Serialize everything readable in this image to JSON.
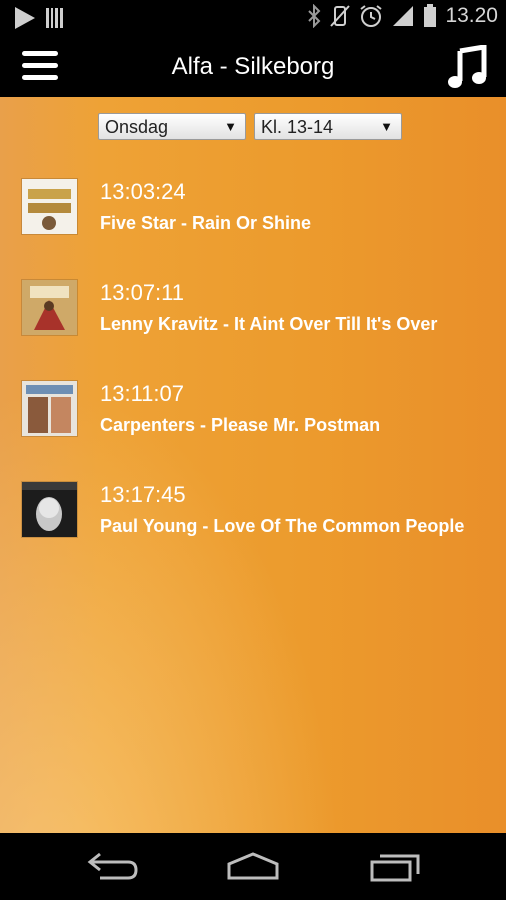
{
  "status_bar": {
    "time": "13.20",
    "icons": [
      "play-icon",
      "barcode-icon",
      "bluetooth-icon",
      "vibrate-off-icon",
      "alarm-icon",
      "signal-icon",
      "battery-icon"
    ]
  },
  "app_bar": {
    "title": "Alfa - Silkeborg",
    "menu_icon": "hamburger-menu-icon",
    "music_icon": "music-note-icon"
  },
  "filters": {
    "day": "Onsdag",
    "hour": "Kl. 13-14"
  },
  "tracks": [
    {
      "time": "13:03:24",
      "title": "Five Star - Rain Or Shine"
    },
    {
      "time": "13:07:11",
      "title": "Lenny Kravitz - It Aint Over Till It's Over"
    },
    {
      "time": "13:11:07",
      "title": "Carpenters - Please Mr. Postman"
    },
    {
      "time": "13:17:45",
      "title": "Paul Young - Love Of The Common People"
    }
  ],
  "nav_bar": {
    "icons": [
      "back-icon",
      "home-icon",
      "recent-apps-icon"
    ]
  },
  "colors": {
    "content_bg": "#ec9b2d",
    "bar_bg": "#000000",
    "text": "#ffffff"
  }
}
